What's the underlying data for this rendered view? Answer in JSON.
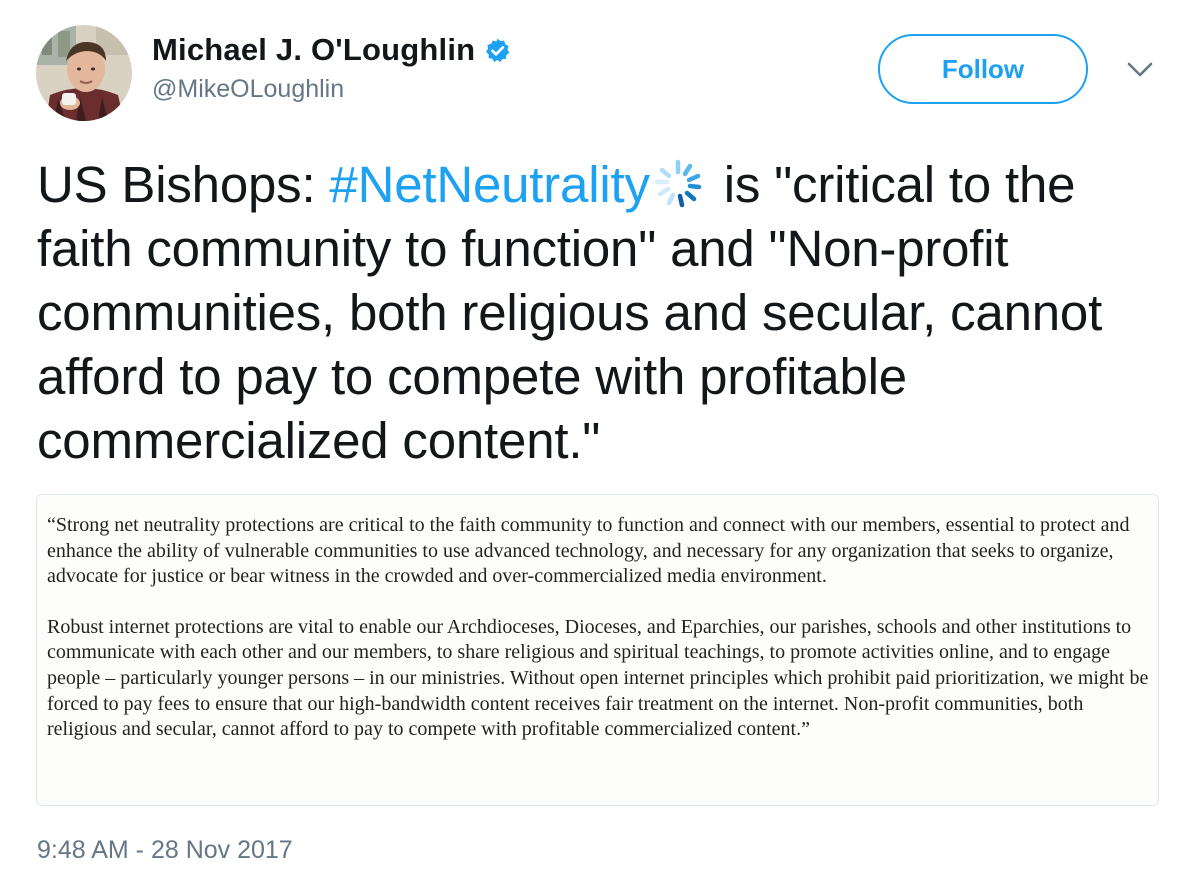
{
  "author": {
    "display_name": "Michael J. O'Loughlin",
    "handle": "@MikeOLoughlin",
    "avatar_icon": "avatar-photo",
    "verified_icon": "verified-badge-icon"
  },
  "follow_label": "Follow",
  "menu_icon": "chevron-down-icon",
  "tweet": {
    "text_before": "US Bishops: ",
    "hashtag": "#NetNeutrality",
    "hashflag_icon": "loading-spinner-icon",
    "text_after": " is \"critical to the faith community to function\" and \"Non-profit communities, both religious and secular, cannot afford to pay to compete with profitable commercialized content.\""
  },
  "media": {
    "paragraph_1": "“Strong net neutrality protections are critical to the faith community to function and connect with our members, essential to protect and enhance the ability of vulnerable communities to use advanced technology, and necessary for any organization that seeks to organize, advocate for justice or bear witness in the crowded and over-commercialized media environment.",
    "paragraph_2": "Robust internet protections are vital to enable our Archdioceses, Dioceses, and Eparchies, our parishes, schools and other institutions to communicate with each other and our members, to share religious and spiritual teachings, to promote activities online, and to engage people – particularly younger persons – in our ministries.  Without open internet principles which prohibit paid prioritization, we might be forced to pay fees to ensure that our high-bandwidth content receives fair treatment on the internet.  Non-profit communities, both religious and secular, cannot afford to pay to compete with profitable commercialized content.”"
  },
  "timestamp": "9:48 AM - 28 Nov 2017",
  "colors": {
    "accent": "#1da1f2",
    "text": "#14171a",
    "secondary": "#657786",
    "border": "#e1e8ed"
  }
}
